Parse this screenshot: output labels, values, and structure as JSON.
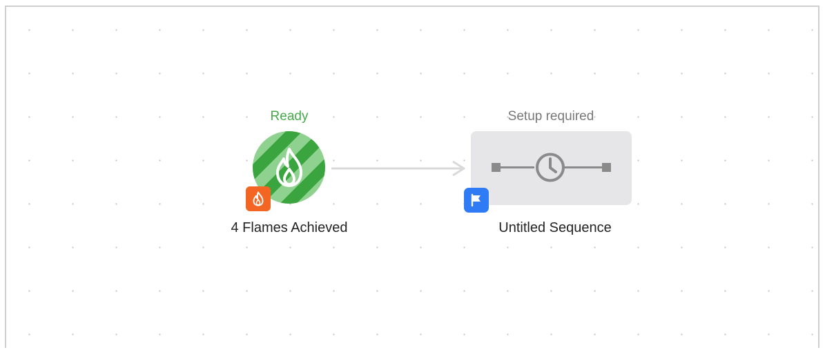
{
  "workflow": {
    "trigger": {
      "status": "Ready",
      "label": "4 Flames Achieved",
      "icon": "flame-icon",
      "badge_icon": "flame-icon",
      "status_color": "#46a94a",
      "badge_color": "#f26522"
    },
    "sequence": {
      "status": "Setup required",
      "label": "Untitled Sequence",
      "icon": "clock-icon",
      "badge_icon": "flag-icon",
      "badge_color": "#2f7bf5"
    },
    "connector": {
      "icon": "arrow-right-icon"
    }
  }
}
